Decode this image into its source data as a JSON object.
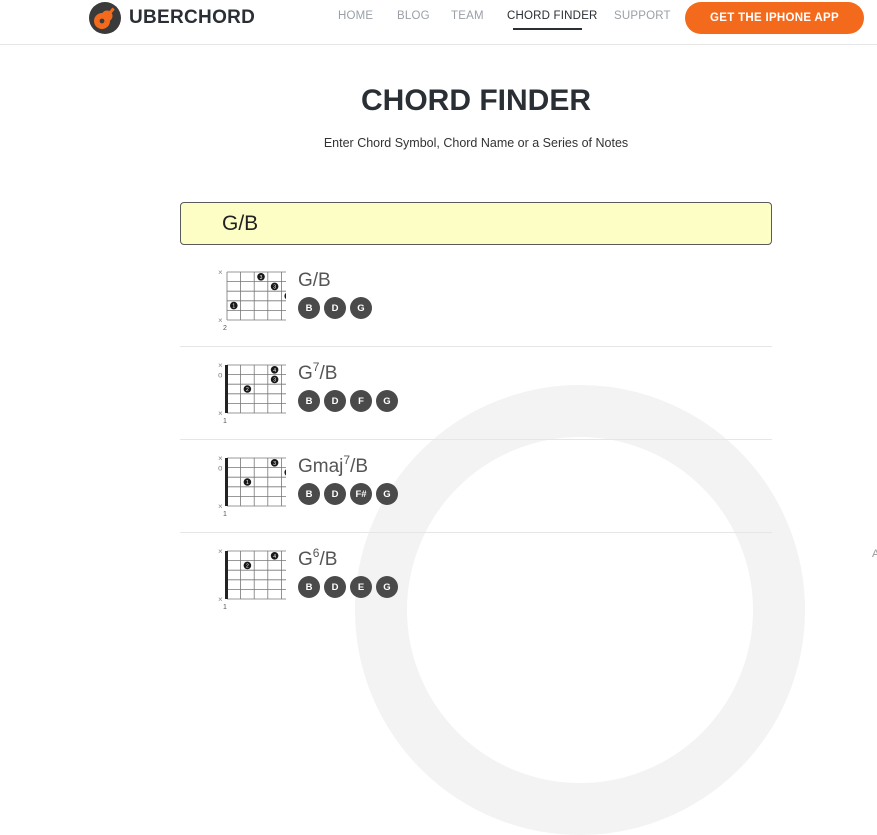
{
  "header": {
    "brand": "UBERCHORD",
    "nav": [
      "HOME",
      "BLOG",
      "TEAM",
      "CHORD FINDER",
      "SUPPORT"
    ],
    "active_nav": "CHORD FINDER",
    "cta": "GET THE IPHONE APP"
  },
  "colors": {
    "accent": "#f46a1c",
    "dark": "#2a2f35",
    "search_bg": "#fdfdc6",
    "note_bg": "#4a4a4a"
  },
  "page": {
    "title": "CHORD FINDER",
    "subtitle": "Enter Chord Symbol, Chord Name or a Series of Notes"
  },
  "search": {
    "value": "G/B"
  },
  "results": [
    {
      "name": {
        "root": "G",
        "sup": "",
        "bass": "/B"
      },
      "notes": [
        "B",
        "D",
        "G"
      ],
      "strings": [
        "x",
        "",
        "",
        "",
        "",
        "x"
      ],
      "base_fret": "2",
      "barre": false,
      "dots": [
        {
          "s": 2,
          "f": 1,
          "n": "3"
        },
        {
          "s": 3,
          "f": 2,
          "n": "3"
        },
        {
          "s": 4,
          "f": 3,
          "n": "4"
        },
        {
          "s": 0,
          "f": 4,
          "n": "1"
        }
      ]
    },
    {
      "name": {
        "root": "G",
        "sup": "7",
        "bass": "/B"
      },
      "notes": [
        "B",
        "D",
        "F",
        "G"
      ],
      "strings": [
        "x",
        "o",
        "",
        "",
        "",
        "x"
      ],
      "base_fret": "1",
      "barre": true,
      "dots": [
        {
          "s": 3,
          "f": 1,
          "n": "4"
        },
        {
          "s": 3,
          "f": 2,
          "n": "3"
        },
        {
          "s": 1,
          "f": 3,
          "n": "2"
        }
      ]
    },
    {
      "name": {
        "root": "Gmaj",
        "sup": "7",
        "bass": "/B"
      },
      "notes": [
        "B",
        "D",
        "F#",
        "G"
      ],
      "strings": [
        "x",
        "o",
        "",
        "",
        "",
        "x"
      ],
      "base_fret": "1",
      "barre": true,
      "dots": [
        {
          "s": 3,
          "f": 1,
          "n": "3"
        },
        {
          "s": 4,
          "f": 2,
          "n": "4"
        },
        {
          "s": 1,
          "f": 3,
          "n": "1"
        }
      ]
    },
    {
      "name": {
        "root": "G",
        "sup": "6",
        "bass": "/B"
      },
      "notes": [
        "B",
        "D",
        "E",
        "G"
      ],
      "strings": [
        "x",
        "",
        "",
        "",
        "",
        "x"
      ],
      "base_fret": "1",
      "barre": true,
      "dots": [
        {
          "s": 3,
          "f": 1,
          "n": "4"
        },
        {
          "s": 1,
          "f": 2,
          "n": "2"
        }
      ]
    }
  ]
}
